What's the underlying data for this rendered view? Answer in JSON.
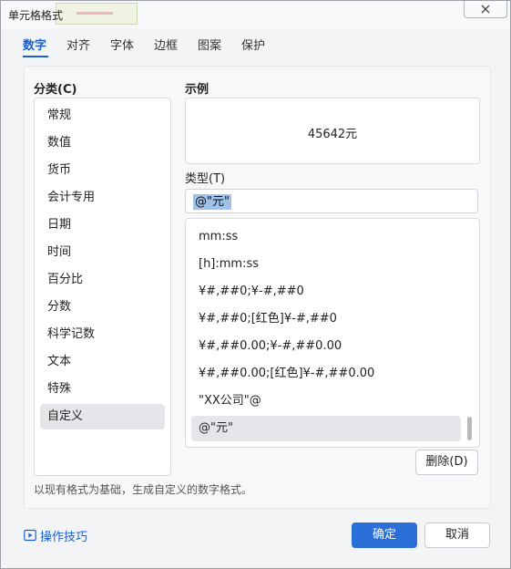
{
  "window": {
    "title": "单元格格式"
  },
  "tabs": [
    {
      "label": "数字",
      "active": true
    },
    {
      "label": "对齐"
    },
    {
      "label": "字体"
    },
    {
      "label": "边框"
    },
    {
      "label": "图案"
    },
    {
      "label": "保护"
    }
  ],
  "category": {
    "label": "分类(C)",
    "items": [
      "常规",
      "数值",
      "货币",
      "会计专用",
      "日期",
      "时间",
      "百分比",
      "分数",
      "科学记数",
      "文本",
      "特殊",
      "自定义"
    ],
    "selected": "自定义"
  },
  "sample": {
    "label": "示例",
    "value": "45642元"
  },
  "type": {
    "label": "类型(T)",
    "value": "@\"元\""
  },
  "formats": {
    "items": [
      "mm:ss",
      "[h]:mm:ss",
      "¥#,##0;¥-#,##0",
      "¥#,##0;[红色]¥-#,##0",
      "¥#,##0.00;¥-#,##0.00",
      "¥#,##0.00;[红色]¥-#,##0.00",
      "\"XX公司\"@",
      "@\"元\""
    ],
    "selected": "@\"元\""
  },
  "buttons": {
    "delete": "删除(D)",
    "ok": "确定",
    "cancel": "取消"
  },
  "hint": "以现有格式为基础，生成自定义的数字格式。",
  "tips": {
    "label": "操作技巧"
  },
  "colors": {
    "accent": "#2b6fd9",
    "tab_active": "#1a5fd0",
    "selection": "#9ec2ea"
  }
}
